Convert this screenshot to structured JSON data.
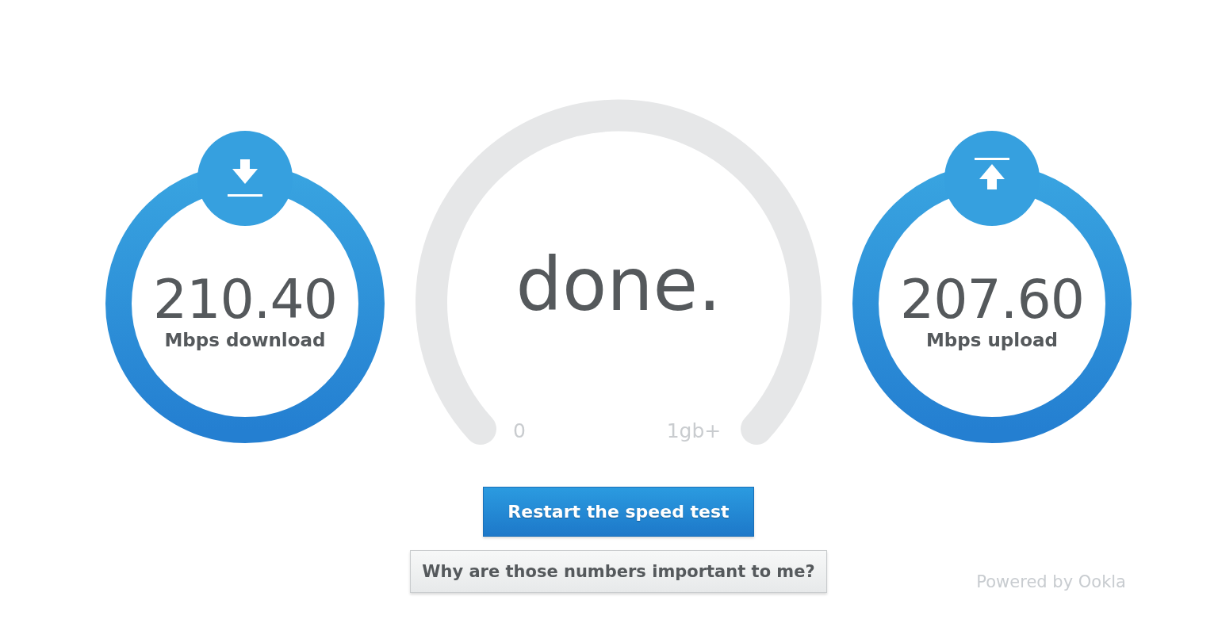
{
  "metrics": [
    {
      "kind": "download",
      "value": "210.40",
      "label": "Mbps download"
    },
    {
      "kind": "upload",
      "value": "207.60",
      "label": "Mbps upload"
    }
  ],
  "gauge": {
    "status": "done.",
    "min_label": "0",
    "max_label": "1gb+"
  },
  "buttons": [
    {
      "kind": "primary",
      "label": "Restart the speed test"
    },
    {
      "kind": "secondary",
      "label": "Why are those numbers important to me?"
    }
  ],
  "footer": {
    "credit": "Powered by Ookla"
  }
}
